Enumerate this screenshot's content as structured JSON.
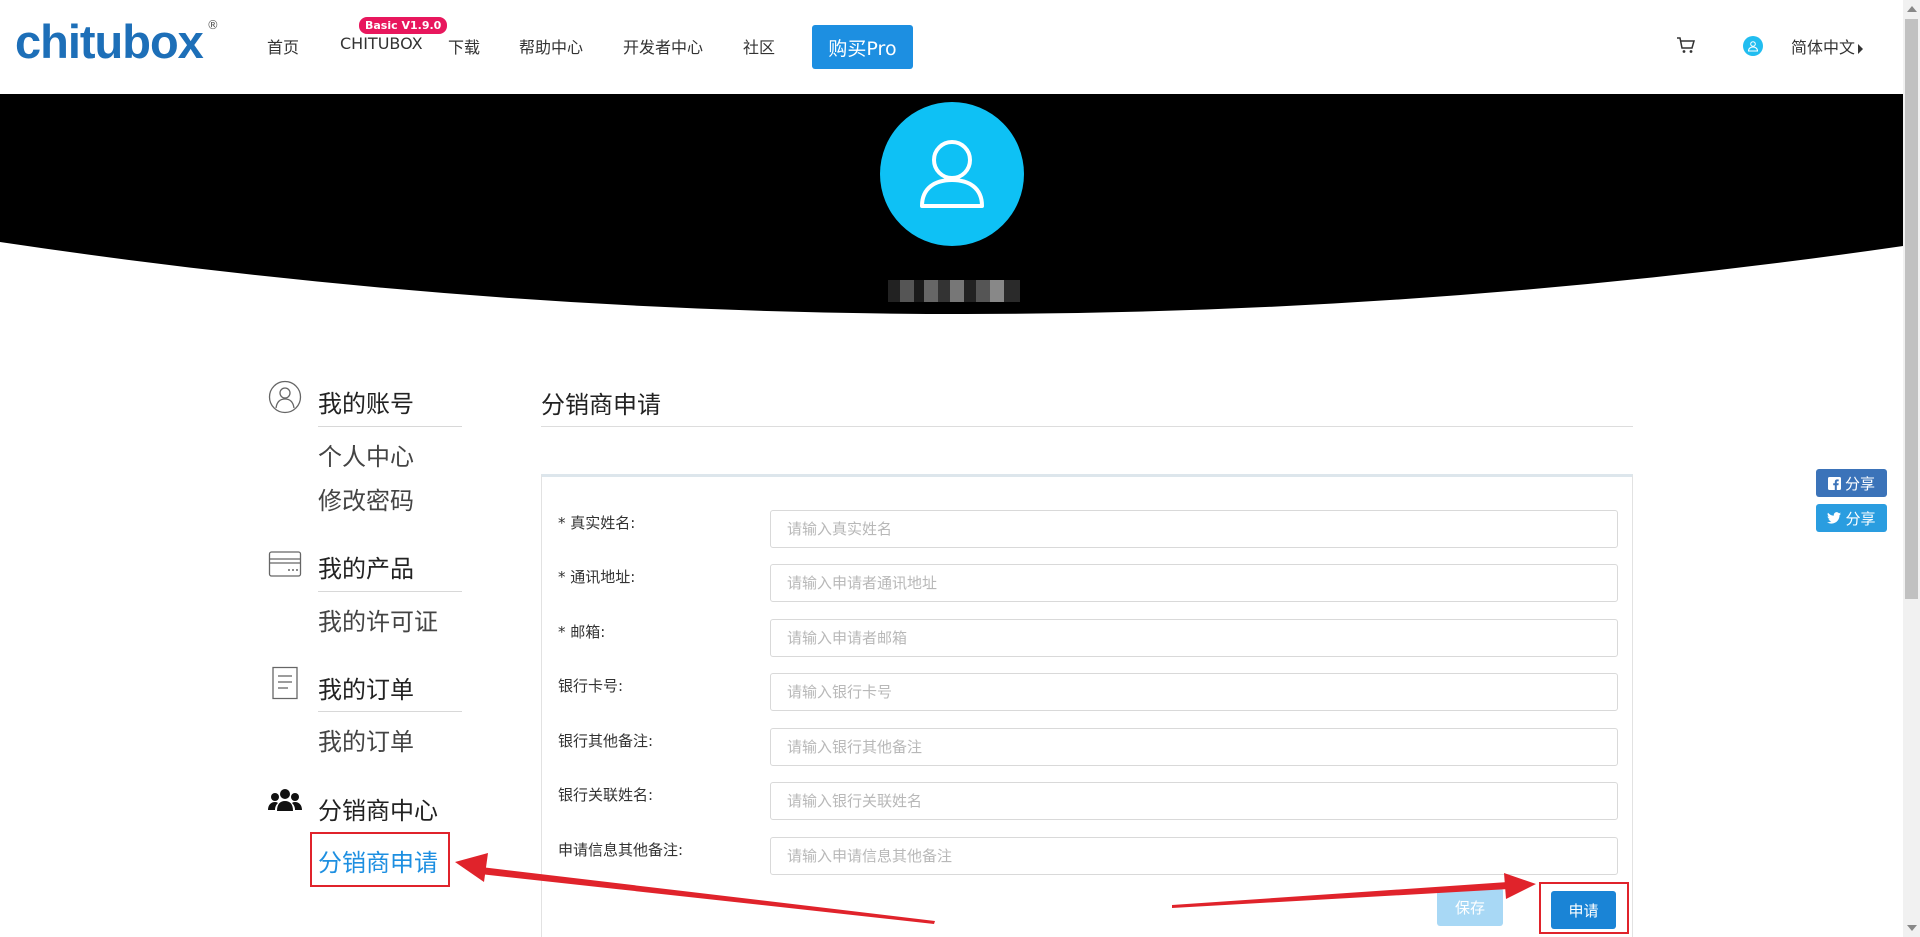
{
  "header": {
    "logo_text": "chitubox",
    "logo_reg": "®",
    "nav": [
      "首页",
      "CHITUBOX",
      "下载",
      "帮助中心",
      "开发者中心",
      "社区"
    ],
    "badge": "Basic V1.9.0",
    "buy_pro": "购买Pro",
    "language": "简体中文"
  },
  "sidebar": {
    "account": {
      "heading": "我的账号",
      "links": [
        "个人中心",
        "修改密码"
      ]
    },
    "products": {
      "heading": "我的产品",
      "links": [
        "我的许可证"
      ]
    },
    "orders": {
      "heading": "我的订单",
      "links": [
        "我的订单"
      ]
    },
    "distributor": {
      "heading": "分销商中心",
      "links": [
        "分销商申请"
      ]
    }
  },
  "main": {
    "title": "分销商申请",
    "fields": [
      {
        "label": "* 真实姓名:",
        "placeholder": "请输入真实姓名",
        "value": ""
      },
      {
        "label": "* 通讯地址:",
        "placeholder": "请输入申请者通讯地址",
        "value": ""
      },
      {
        "label": "* 邮箱:",
        "placeholder": "请输入申请者邮箱",
        "value": ""
      },
      {
        "label": "银行卡号:",
        "placeholder": "请输入银行卡号",
        "value": ""
      },
      {
        "label": "银行其他备注:",
        "placeholder": "请输入银行其他备注",
        "value": ""
      },
      {
        "label": "银行关联姓名:",
        "placeholder": "请输入银行关联姓名",
        "value": ""
      },
      {
        "label": "申请信息其他备注:",
        "placeholder": "请输入申请信息其他备注",
        "value": ""
      }
    ],
    "save_label": "保存",
    "apply_label": "申请"
  },
  "share": {
    "facebook": "分享",
    "twitter": "分享"
  },
  "colors": {
    "brand_blue": "#1d6fb8",
    "accent_blue": "#1d8fe1",
    "avatar_cyan": "#0ec1f5",
    "badge_pink": "#e8175d",
    "annotation_red": "#e0232b"
  }
}
